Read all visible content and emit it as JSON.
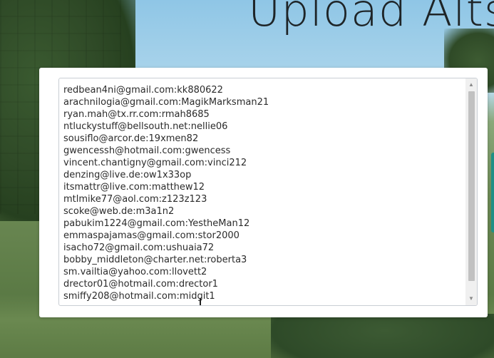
{
  "page": {
    "title": "Upload Alts"
  },
  "upload_form": {
    "accounts_textarea": {
      "lines": [
        "redbean4ni@gmail.com:kk880622",
        "arachnilogia@gmail.com:MagikMarksman21",
        "ryan.mah@tx.rr.com:rmah8685",
        "ntluckystuff@bellsouth.net:nellie06",
        "sousiflo@arcor.de:19xmen82",
        "gwencessh@hotmail.com:gwencess",
        "vincent.chantigny@gmail.com:vinci212",
        "denzing@live.de:ow1x33op",
        "itsmattr@live.com:matthew12",
        "mtlmike77@aol.com:z123z123",
        "scoke@web.de:m3a1n2",
        "pabukim1224@gmail.com:YestheMan12",
        "emmaspajamas@gmail.com:stor2000",
        "isacho72@gmail.com:ushuaia72",
        "bobby_middleton@charter.net:roberta3",
        "sm.vailtia@yahoo.com:llovett2",
        "drector01@hotmail.com:drector1",
        "smiffy208@hotmail.com:midgit1"
      ]
    }
  },
  "icons": {
    "scroll_up": "chevron-up-icon",
    "scroll_down": "chevron-down-icon"
  },
  "colors": {
    "title": "#1e2427",
    "card": "#ffffff",
    "accent_teal": "#1f8f86"
  }
}
